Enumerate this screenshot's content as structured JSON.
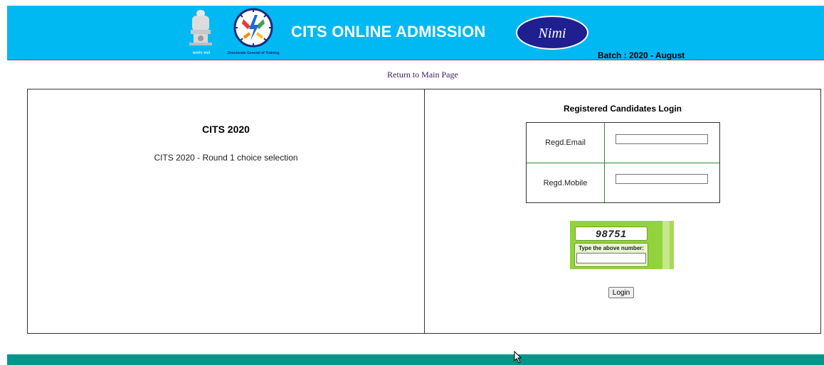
{
  "header": {
    "emblem_caption": "सत्यमेव जयते",
    "dgt_caption": "Directorate General of Training",
    "title": "CITS ONLINE ADMISSION",
    "nimi_logo_text": "Nimi",
    "batch": "Batch : 2020 - August",
    "background_color": "#00b9f2"
  },
  "nav": {
    "return_link": "Return to Main Page"
  },
  "left_panel": {
    "title": "CITS 2020",
    "description": "CITS 2020 - Round 1 choice selection"
  },
  "login": {
    "title": "Registered Candidates Login",
    "fields": [
      {
        "label": "Regd.Email",
        "value": "",
        "placeholder": ""
      },
      {
        "label": "Regd.Mobile",
        "value": "",
        "placeholder": ""
      }
    ],
    "captcha": {
      "number": "98751",
      "prompt": "Type the above number:",
      "value": ""
    },
    "button_label": "Login"
  },
  "footer": {
    "color": "#00968a"
  },
  "icons": [
    "national-emblem-icon",
    "dgt-logo-icon",
    "nimi-logo-icon",
    "mouse-cursor-icon"
  ]
}
